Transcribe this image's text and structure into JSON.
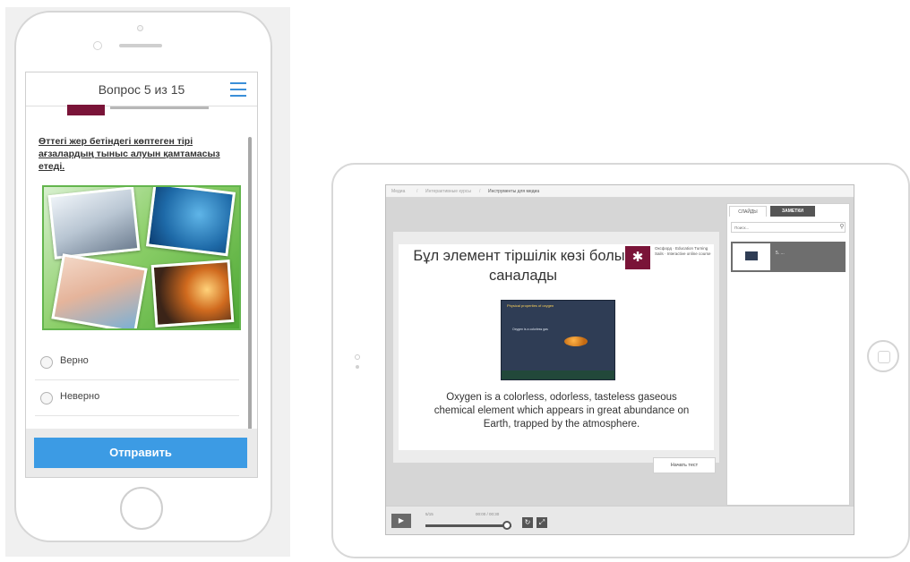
{
  "phone": {
    "header": {
      "progress": "Вопрос 5 из 15"
    },
    "question": "Өттегі жер бетіндегі көптеген тірі ағзалардың тыныс алуын қамтамасыз етеді.",
    "options": [
      {
        "label": "Верно"
      },
      {
        "label": "Неверно"
      }
    ],
    "submit_label": "Отправить",
    "colors": {
      "accent": "#3c9be4",
      "brand": "#7a1438"
    }
  },
  "tablet": {
    "breadcrumbs": [
      "Медиа",
      "Интерактивные курсы",
      "Инструменты для медиа"
    ],
    "breadcrumb_separator": "/",
    "slide": {
      "title": "Бұл элемент тіршілік көзі болып саналады",
      "logo_text": "Оксфорд · Education Turning Sails · Interactive online course",
      "image_title": "Physical properties of oxygen",
      "image_text": "Oxygen is a colorless gas",
      "caption": "Oxygen is a colorless, odorless, tasteless gaseous chemical element which appears in great abundance on Earth, trapped by the atmosphere."
    },
    "start_test_label": "Начать тест",
    "sidebar": {
      "tabs": [
        {
          "label": "СЛАЙДЫ"
        },
        {
          "label": "ЗАМЕТКИ"
        }
      ],
      "search_placeholder": "Поиск...",
      "thumb_label": "5. ..."
    },
    "player": {
      "slide_counter": "5/15",
      "time": "00:00 / 00:30",
      "progress": 0.95
    }
  }
}
